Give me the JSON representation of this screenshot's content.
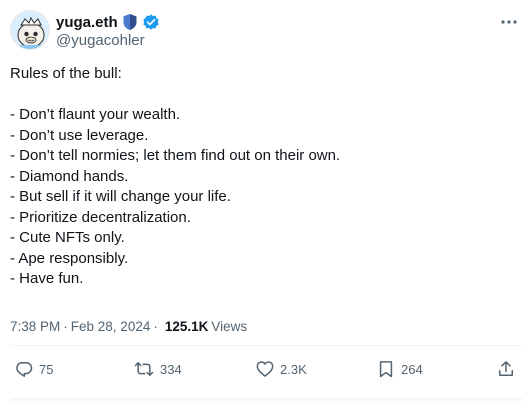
{
  "author": {
    "display_name": "yuga.eth",
    "handle": "@yugacohler",
    "avatar_icon": "ape-avatar-icon",
    "affiliate_badge": "shield-badge-icon",
    "verified_badge": "verified-check-icon",
    "verified_color": "#1d9bf0"
  },
  "tweet": {
    "lines": [
      "Rules of the bull:",
      "",
      "- Don’t flaunt your wealth.",
      "- Don’t use leverage.",
      "- Don’t tell normies; let them find out on their own.",
      "- Diamond hands.",
      "- But sell if it will change your life.",
      "- Prioritize decentralization.",
      "- Cute NFTs only.",
      "- Ape responsibly.",
      "- Have fun."
    ]
  },
  "meta": {
    "time": "7:38 PM",
    "separator": "·",
    "date": "Feb 28, 2024",
    "views_count": "125.1K",
    "views_label": "Views"
  },
  "actions": {
    "reply": {
      "icon": "reply-icon",
      "count": "75"
    },
    "repost": {
      "icon": "repost-icon",
      "count": "334"
    },
    "like": {
      "icon": "heart-icon",
      "count": "2.3K"
    },
    "bookmark": {
      "icon": "bookmark-icon",
      "count": "264"
    },
    "share": {
      "icon": "share-icon"
    }
  },
  "colors": {
    "text": "#0f1419",
    "secondary": "#536471",
    "accent": "#1d9bf0"
  }
}
